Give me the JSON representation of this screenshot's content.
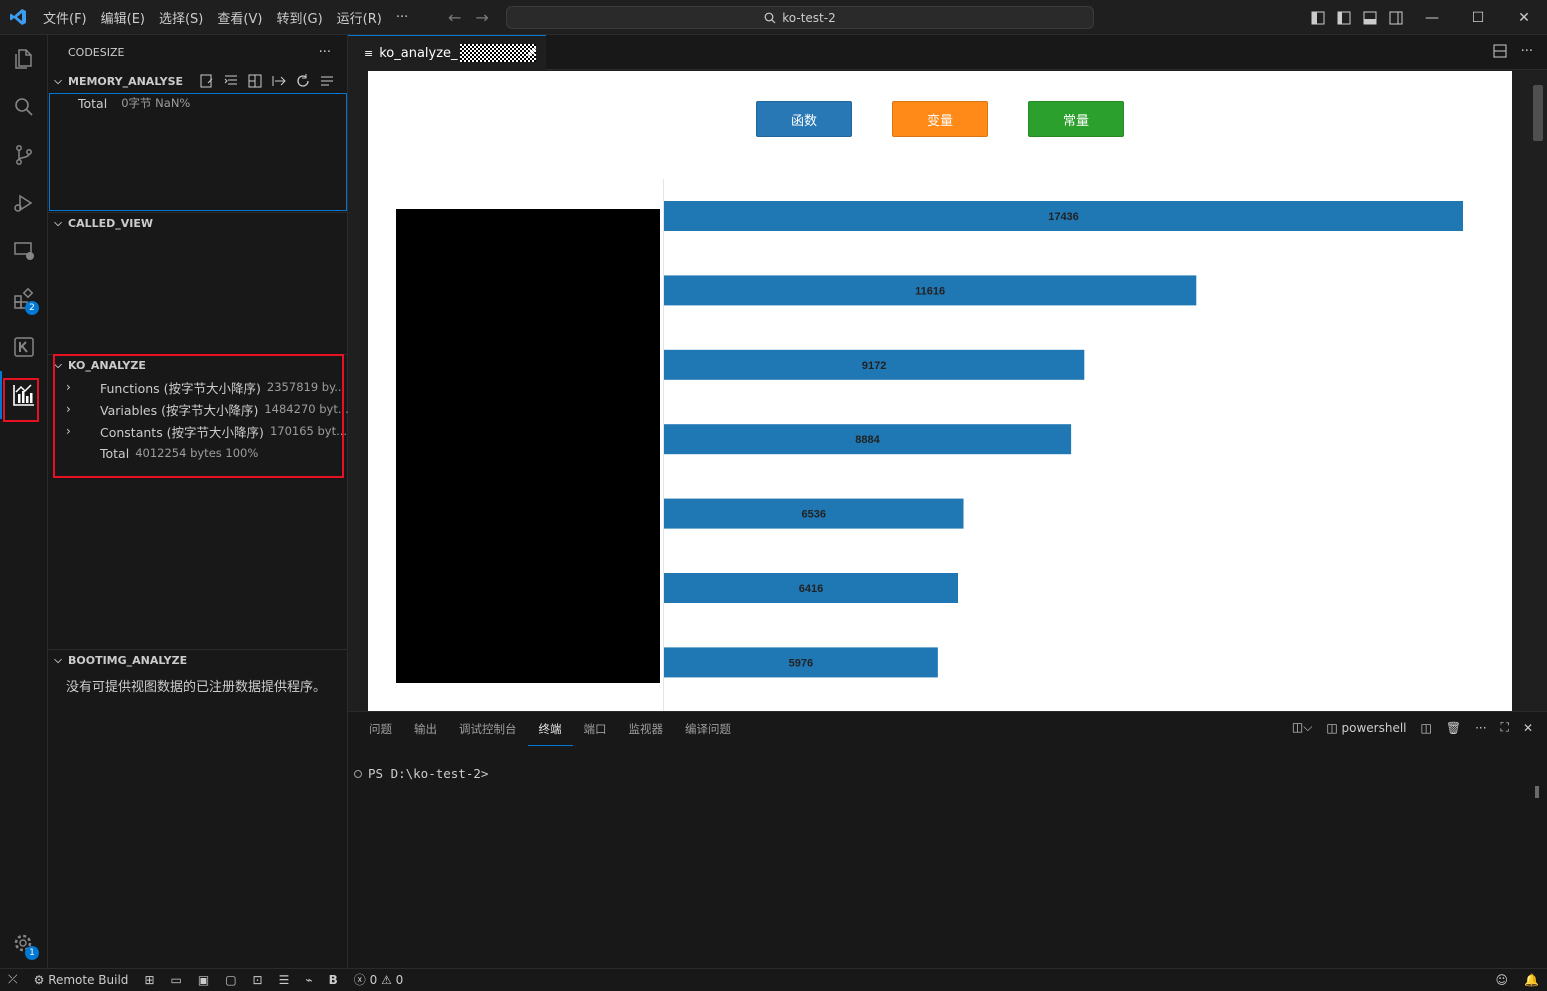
{
  "titlebar": {
    "menu": [
      "文件(F)",
      "编辑(E)",
      "选择(S)",
      "查看(V)",
      "转到(G)",
      "运行(R)",
      "···"
    ],
    "search_text": "ko-test-2"
  },
  "activity": {
    "extensions_badge": "2",
    "settings_badge": "1"
  },
  "sidebar": {
    "title": "CODESIZE",
    "memory_analyse": {
      "header": "MEMORY_ANALYSE",
      "total_label": "Total",
      "total_desc": "0字节  NaN%"
    },
    "called_view": {
      "header": "CALLED_VIEW"
    },
    "ko_analyze": {
      "header": "KO_ANALYZE",
      "items": [
        {
          "label": "Functions (按字节大小降序)",
          "desc": "2357819 by..."
        },
        {
          "label": "Variables (按字节大小降序)",
          "desc": "1484270 byt..."
        },
        {
          "label": "Constants (按字节大小降序)",
          "desc": "170165 byt..."
        },
        {
          "label": "Total",
          "desc": "4012254 bytes 100%"
        }
      ]
    },
    "booting_analyze": {
      "header": "BOOTIMG_ANALYZE",
      "message": "没有可提供视图数据的已注册数据提供程序。"
    }
  },
  "editor": {
    "tab_label": "ko_analyze_",
    "buttons": [
      {
        "label": "函数",
        "color": "#2878b5"
      },
      {
        "label": "变量",
        "color": "#ff8a17"
      },
      {
        "label": "常量",
        "color": "#2ca02c"
      }
    ]
  },
  "chart_data": {
    "type": "bar",
    "orientation": "horizontal",
    "bar_color": "#1f77b4",
    "values": [
      17436,
      11616,
      9172,
      8884,
      6536,
      6416,
      5976
    ],
    "xlim": [
      0,
      17436
    ]
  },
  "panel": {
    "tabs": [
      "问题",
      "输出",
      "调试控制台",
      "终端",
      "端口",
      "监视器",
      "编译问题"
    ],
    "active_tab": 3,
    "shell": "powershell",
    "prompt": "PS D:\\ko-test-2>"
  },
  "statusbar": {
    "remote": "Remote Build",
    "errors": "0",
    "warnings": "0"
  }
}
